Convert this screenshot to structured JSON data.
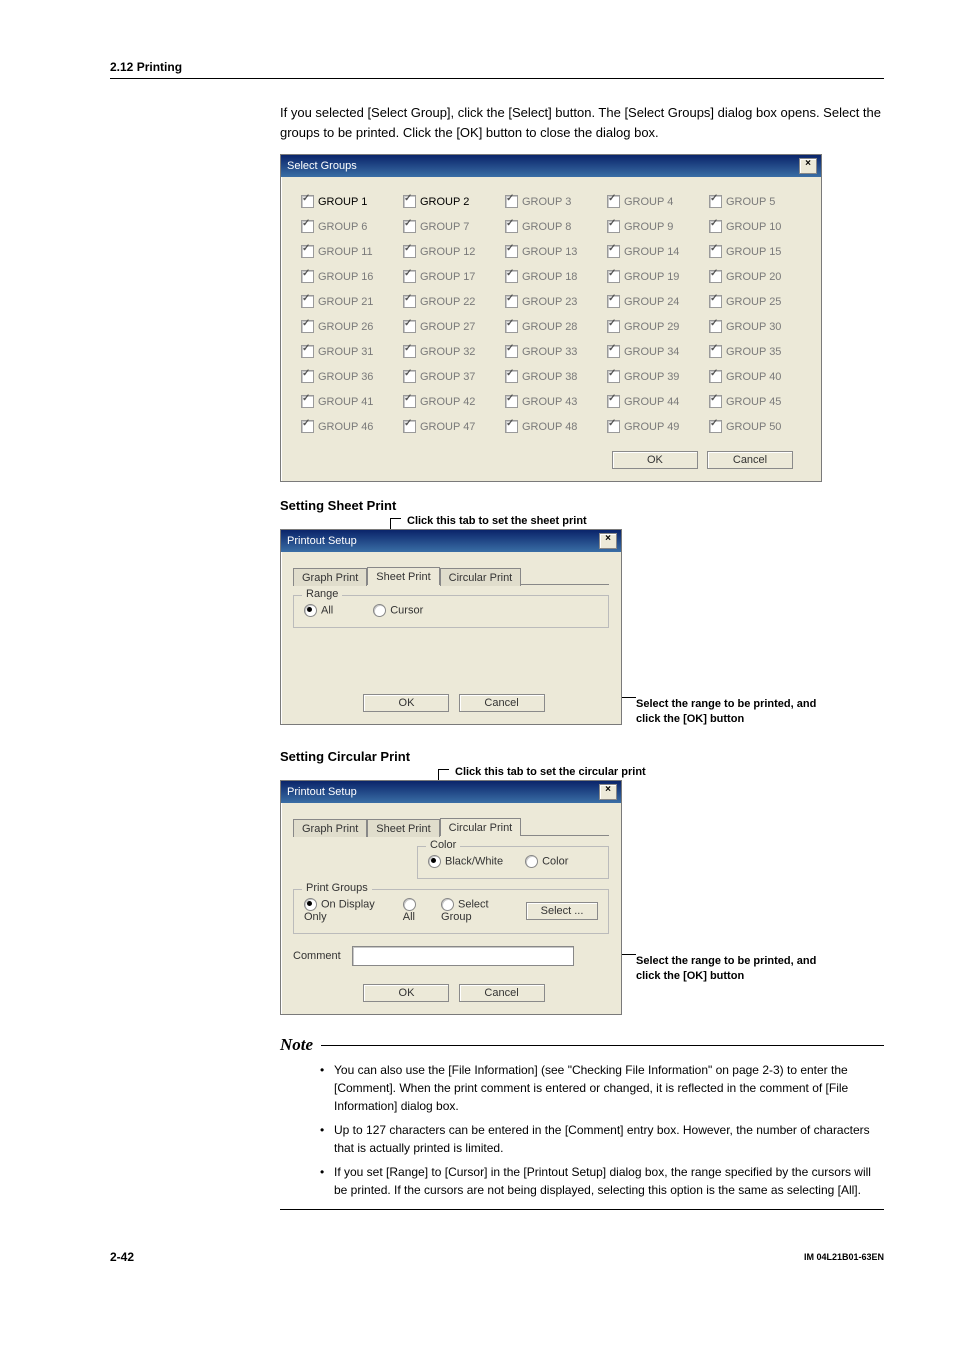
{
  "header": {
    "section": "2.12  Printing"
  },
  "intro": "If you selected [Select Group], click the [Select] button. The [Select Groups] dialog box opens. Select the groups to be printed. Click the [OK] button to close the dialog box.",
  "select_groups": {
    "title": "Select Groups",
    "items": [
      "GROUP 1",
      "GROUP 2",
      "GROUP 3",
      "GROUP 4",
      "GROUP 5",
      "GROUP 6",
      "GROUP 7",
      "GROUP 8",
      "GROUP 9",
      "GROUP 10",
      "GROUP 11",
      "GROUP 12",
      "GROUP 13",
      "GROUP 14",
      "GROUP 15",
      "GROUP 16",
      "GROUP 17",
      "GROUP 18",
      "GROUP 19",
      "GROUP 20",
      "GROUP 21",
      "GROUP 22",
      "GROUP 23",
      "GROUP 24",
      "GROUP 25",
      "GROUP 26",
      "GROUP 27",
      "GROUP 28",
      "GROUP 29",
      "GROUP 30",
      "GROUP 31",
      "GROUP 32",
      "GROUP 33",
      "GROUP 34",
      "GROUP 35",
      "GROUP 36",
      "GROUP 37",
      "GROUP 38",
      "GROUP 39",
      "GROUP 40",
      "GROUP 41",
      "GROUP 42",
      "GROUP 43",
      "GROUP 44",
      "GROUP 45",
      "GROUP 46",
      "GROUP 47",
      "GROUP 48",
      "GROUP 49",
      "GROUP 50"
    ],
    "ok": "OK",
    "cancel": "Cancel"
  },
  "sheet": {
    "heading": "Setting Sheet Print",
    "callout": "Click this tab to set the sheet print",
    "dialog_title": "Printout Setup",
    "tabs": {
      "graph": "Graph Print",
      "sheet": "Sheet Print",
      "circular": "Circular Print"
    },
    "range_legend": "Range",
    "all": "All",
    "cursor": "Cursor",
    "ok": "OK",
    "cancel": "Cancel",
    "side": "Select the range to be printed, and click the [OK] button"
  },
  "circular": {
    "heading": "Setting Circular Print",
    "callout": "Click this tab to set the circular print",
    "dialog_title": "Printout Setup",
    "tabs": {
      "graph": "Graph Print",
      "sheet": "Sheet Print",
      "circular": "Circular Print"
    },
    "color_legend": "Color",
    "bw": "Black/White",
    "color": "Color",
    "pg_legend": "Print Groups",
    "on_display": "On Display Only",
    "all": "All",
    "select_group": "Select Group",
    "select_btn": "Select ...",
    "comment_label": "Comment",
    "ok": "OK",
    "cancel": "Cancel",
    "side": "Select the range to be printed, and click the [OK] button"
  },
  "note": {
    "title": "Note",
    "items": [
      "You can also use the [File Information] (see \"Checking File Information\" on page 2-3) to enter the [Comment]. When the print comment is entered or changed, it is reflected in the comment of [File Information] dialog box.",
      "Up to 127 characters can be entered in the [Comment] entry box. However, the number of characters that is actually printed is limited.",
      "If you set [Range] to [Cursor] in the [Printout Setup] dialog box, the range specified by the cursors will be printed. If the cursors are not being displayed, selecting this option is the same as selecting [All]."
    ]
  },
  "footer": {
    "page": "2-42",
    "doc": "IM 04L21B01-63EN"
  }
}
